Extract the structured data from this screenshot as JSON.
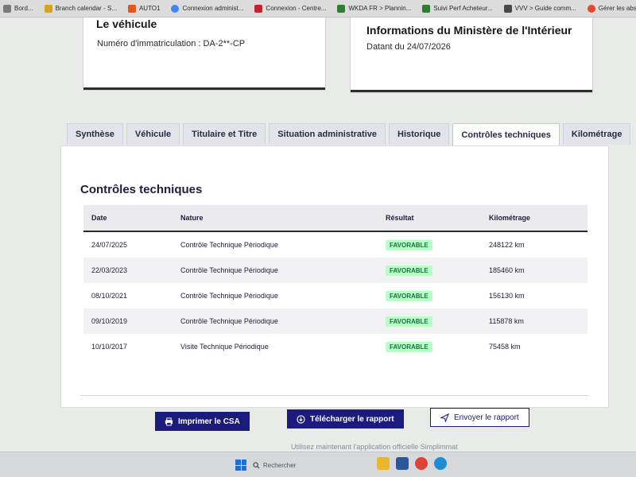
{
  "bookmarks": [
    {
      "label": "Bord...",
      "icon": "bookmark-icon",
      "color": "#7a7a7a"
    },
    {
      "label": "Branch calendar - S...",
      "icon": "calendar-icon",
      "color": "#d9a21b"
    },
    {
      "label": "AUTO1",
      "icon": "auto1-icon",
      "color": "#e8561a"
    },
    {
      "label": "Connexion administ...",
      "icon": "google-icon",
      "color": "#4285f4"
    },
    {
      "label": "Connexion - Centre...",
      "icon": "site-icon",
      "color": "#c8202f"
    },
    {
      "label": "WKDA FR > Plannin...",
      "icon": "sheet-icon",
      "color": "#2e7d32"
    },
    {
      "label": "Suivi Perf Acheteur...",
      "icon": "sheet-icon",
      "color": "#2e7d32"
    },
    {
      "label": "VVV > Guide comm...",
      "icon": "doc-icon",
      "color": "#4a4a4a"
    },
    {
      "label": "Gérer les absences -...",
      "icon": "absence-icon",
      "color": "#e24a2a"
    }
  ],
  "vehicle": {
    "title": "Le véhicule",
    "registration": "Numéro d'immatriculation : DA-2**-CP"
  },
  "ministry": {
    "title": "Informations du Ministère de l'Intérieur",
    "date": "Datant du 24/07/2026"
  },
  "tabs": [
    {
      "label": "Synthèse",
      "active": false
    },
    {
      "label": "Véhicule",
      "active": false
    },
    {
      "label": "Titulaire et Titre",
      "active": false
    },
    {
      "label": "Situation administrative",
      "active": false
    },
    {
      "label": "Historique",
      "active": false
    },
    {
      "label": "Contrôles techniques",
      "active": true
    },
    {
      "label": "Kilométrage",
      "active": false
    }
  ],
  "section": {
    "title": "Contrôles techniques",
    "columns": [
      "Date",
      "Nature",
      "Résultat",
      "Kilométrage"
    ],
    "rows": [
      {
        "date": "24/07/2025",
        "nature": "Contrôle Technique Périodique",
        "result": "FAVORABLE",
        "km": "248122 km"
      },
      {
        "date": "22/03/2023",
        "nature": "Contrôle Technique Périodique",
        "result": "FAVORABLE",
        "km": "185460 km"
      },
      {
        "date": "08/10/2021",
        "nature": "Contrôle Technique Périodique",
        "result": "FAVORABLE",
        "km": "156130 km"
      },
      {
        "date": "09/10/2019",
        "nature": "Contrôle Technique Périodique",
        "result": "FAVORABLE",
        "km": "115878 km"
      },
      {
        "date": "10/10/2017",
        "nature": "Visite Technique Périodique",
        "result": "FAVORABLE",
        "km": "75458 km"
      }
    ]
  },
  "actions": {
    "print": "Imprimer le CSA",
    "download": "Télécharger le rapport",
    "send": "Envoyer le rapport"
  },
  "promo": "Utilisez maintenant l'application officielle Simplimmat",
  "taskbar": {
    "search_placeholder": "Rechercher",
    "apps": [
      {
        "icon": "file-explorer-icon",
        "color": "#e8b82a"
      },
      {
        "icon": "store-icon",
        "color": "#2b579a"
      },
      {
        "icon": "chrome-icon",
        "color": "#db4437"
      },
      {
        "icon": "edge-icon",
        "color": "#1e8bd6"
      }
    ]
  },
  "colors": {
    "primary": "#1b1b7d",
    "badge_bg": "#b8fec9",
    "badge_text": "#18753c"
  }
}
